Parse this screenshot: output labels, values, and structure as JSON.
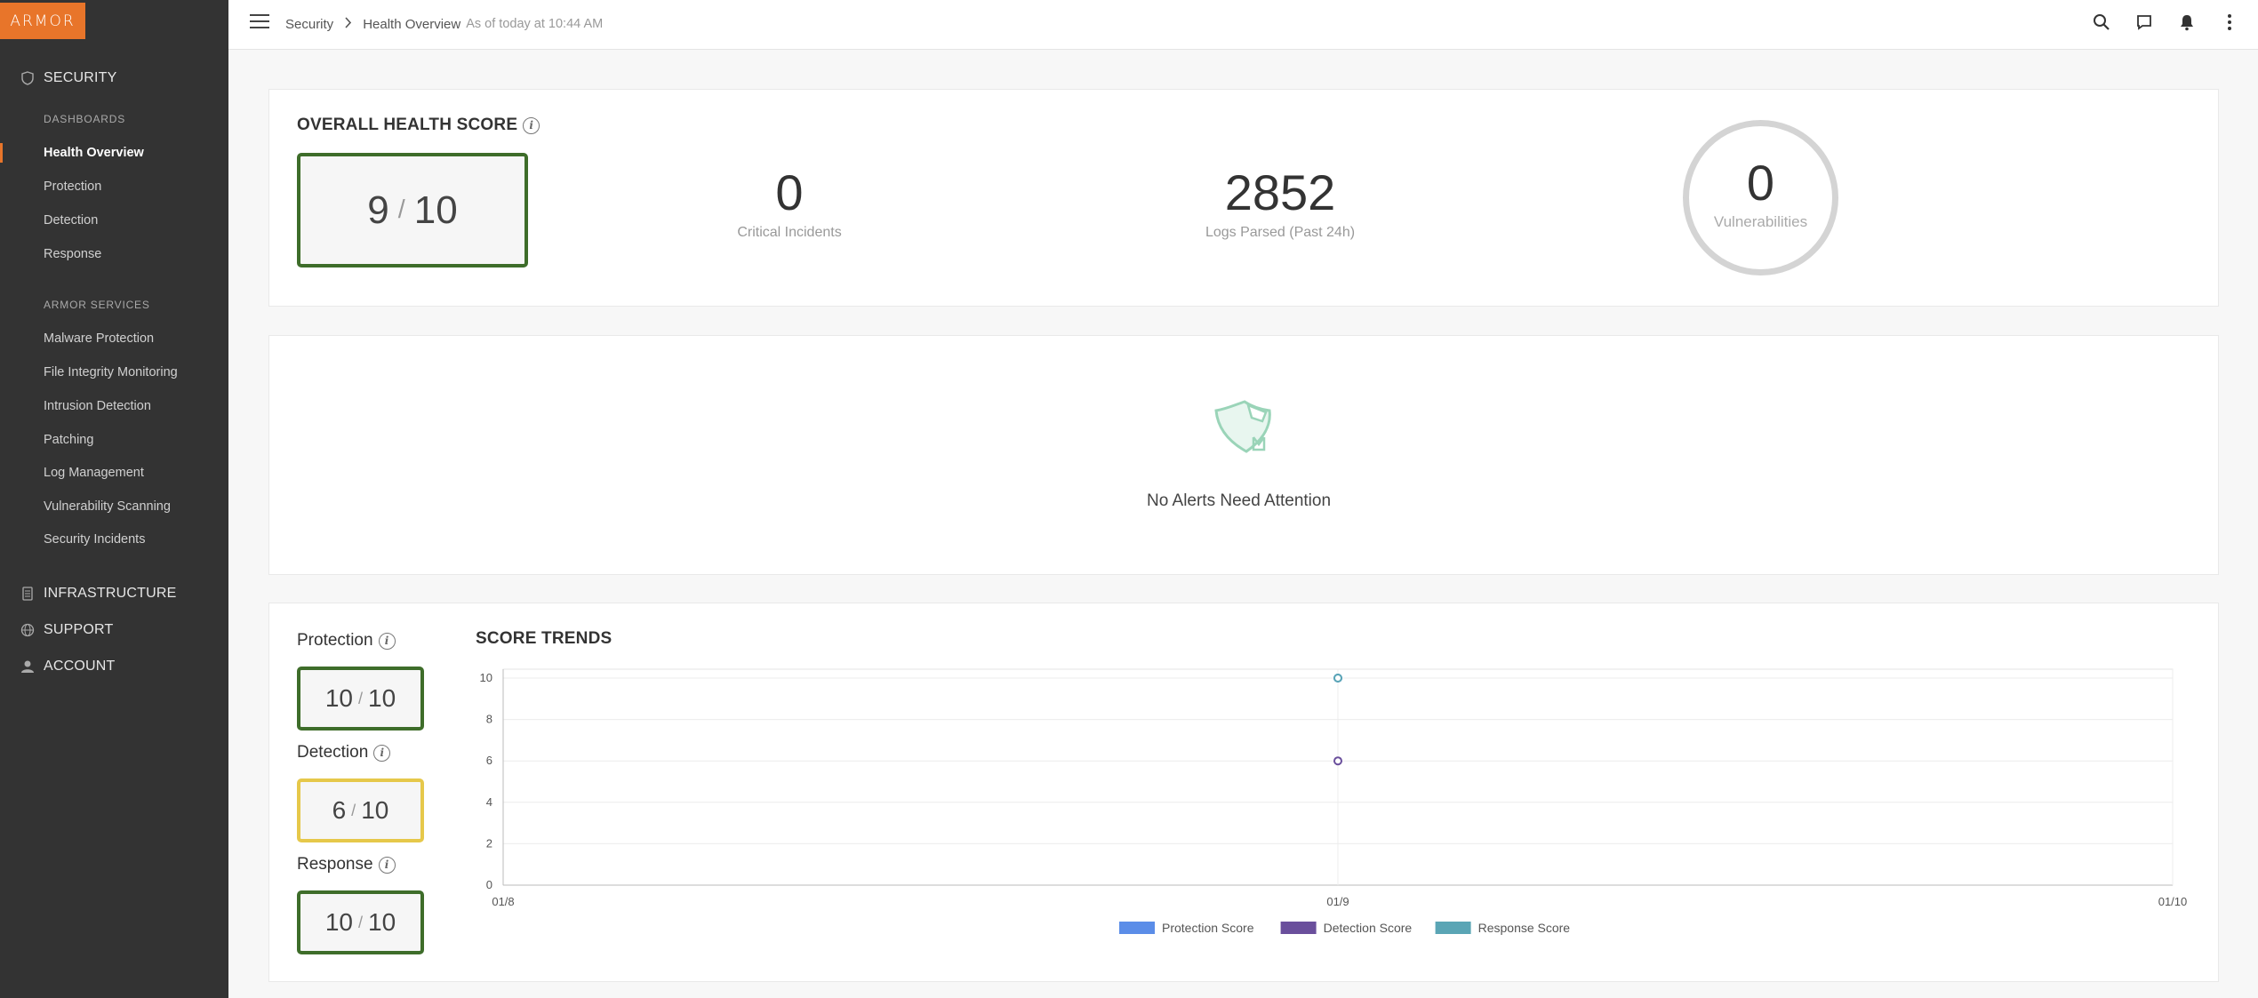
{
  "app": {
    "logo_text": "ARMOR",
    "brand_color": "#e8752a"
  },
  "sidebar": {
    "sections": [
      {
        "label": "SECURITY",
        "icon": "shield-icon"
      },
      {
        "label": "INFRASTRUCTURE",
        "icon": "server-icon"
      },
      {
        "label": "SUPPORT",
        "icon": "globe-icon"
      },
      {
        "label": "ACCOUNT",
        "icon": "user-icon"
      }
    ],
    "groups": [
      {
        "label": "DASHBOARDS",
        "items": [
          "Health Overview",
          "Protection",
          "Detection",
          "Response"
        ]
      },
      {
        "label": "ARMOR SERVICES",
        "items": [
          "Malware Protection",
          "File Integrity Monitoring",
          "Intrusion Detection",
          "Patching",
          "Log Management",
          "Vulnerability Scanning",
          "Security Incidents"
        ]
      }
    ],
    "active_item": "Health Overview"
  },
  "header": {
    "breadcrumb": {
      "root": "Security",
      "current": "Health Overview",
      "subtitle": "As of today at 10:44 AM"
    },
    "icons": [
      "search-icon",
      "chat-icon",
      "bell-icon",
      "more-vert-icon"
    ]
  },
  "overall": {
    "title": "OVERALL HEALTH SCORE",
    "score": "9",
    "max": "10",
    "critical_incidents": {
      "value": "0",
      "label": "Critical Incidents"
    },
    "logs_parsed": {
      "value": "2852",
      "label": "Logs Parsed (Past 24h)"
    },
    "vulnerabilities": {
      "value": "0",
      "label": "Vulnerabilities"
    }
  },
  "alerts": {
    "message": "No Alerts Need Attention"
  },
  "sub_scores": {
    "protection": {
      "label": "Protection",
      "score": "10",
      "max": "10",
      "color": "#3e6d2a"
    },
    "detection": {
      "label": "Detection",
      "score": "6",
      "max": "10",
      "color": "#e6c84a"
    },
    "response": {
      "label": "Response",
      "score": "10",
      "max": "10",
      "color": "#3e6d2a"
    }
  },
  "trends": {
    "title": "SCORE TRENDS"
  },
  "chart_data": {
    "type": "line",
    "title": "SCORE TRENDS",
    "x": [
      "01/8",
      "01/9",
      "01/10"
    ],
    "ylim": [
      0,
      10
    ],
    "yticks": [
      0,
      2,
      4,
      6,
      8,
      10
    ],
    "grid": true,
    "legend": "bottom",
    "series": [
      {
        "name": "Protection Score",
        "color": "#5b8de8",
        "values": [
          null,
          10,
          null
        ]
      },
      {
        "name": "Detection Score",
        "color": "#6a4f9c",
        "values": [
          null,
          6,
          null
        ]
      },
      {
        "name": "Response Score",
        "color": "#5aa5b5",
        "values": [
          null,
          10,
          null
        ]
      }
    ]
  }
}
